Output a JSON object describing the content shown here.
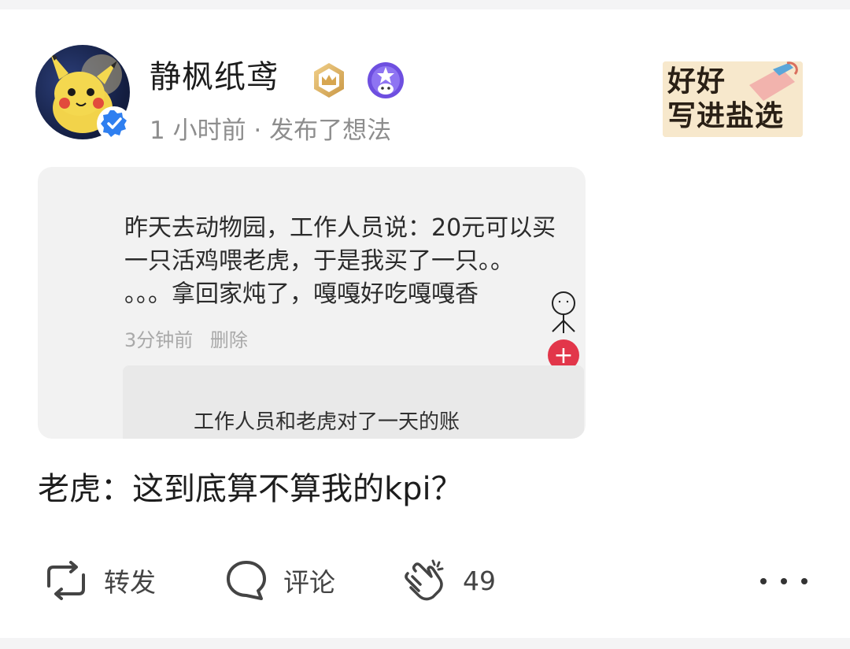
{
  "post": {
    "author": {
      "name": "静枫纸鸢",
      "verified": true,
      "badges": [
        "crown-badge-icon",
        "star-badge-icon"
      ]
    },
    "meta": "1 小时前 · 发布了想法",
    "sticker": {
      "line1": "好好",
      "line2": "写进盐选"
    },
    "image": {
      "lines": [
        "昨天去动物园，工作人员说：20元可以买",
        "一只活鸡喂老虎，于是我买了一只。。",
        "。。。拿回家炖了，嘎嘎好吃嘎嘎香"
      ],
      "comment_time": "3分钟前",
      "comment_delete": "删除",
      "reply": "工作人员和老虎对了一天的账"
    },
    "caption": "老虎：这到底算不算我的kpi？"
  },
  "actions": {
    "repost": "转发",
    "comment": "评论",
    "applause_count": "49"
  },
  "colors": {
    "accent_blue": "#2f7ff0",
    "plus_red": "#e2364a",
    "meta_gray": "#8d8d8d"
  }
}
